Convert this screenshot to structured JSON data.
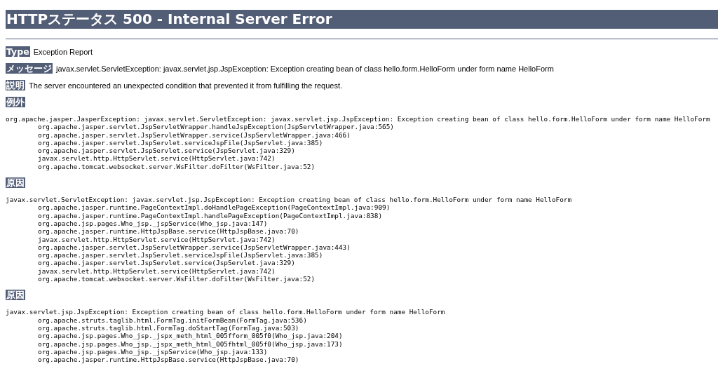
{
  "title": "HTTPステータス 500 - Internal Server Error",
  "fields": [
    {
      "label": "Type",
      "text": "Exception Report"
    },
    {
      "label": "メッセージ",
      "text": "javax.servlet.ServletException: javax.servlet.jsp.JspException: Exception creating bean of class hello.form.HelloForm under form name HelloForm"
    },
    {
      "label": "説明",
      "text": "The server encountered an unexpected condition that prevented it from fulfilling the request."
    }
  ],
  "sections": [
    {
      "label": "例外",
      "head": "org.apache.jasper.JasperException: javax.servlet.ServletException: javax.servlet.jsp.JspException: Exception creating bean of class hello.form.HelloForm under form name HelloForm",
      "frames": [
        "org.apache.jasper.servlet.JspServletWrapper.handleJspException(JspServletWrapper.java:565)",
        "org.apache.jasper.servlet.JspServletWrapper.service(JspServletWrapper.java:466)",
        "org.apache.jasper.servlet.JspServlet.serviceJspFile(JspServlet.java:385)",
        "org.apache.jasper.servlet.JspServlet.service(JspServlet.java:329)",
        "javax.servlet.http.HttpServlet.service(HttpServlet.java:742)",
        "org.apache.tomcat.websocket.server.WsFilter.doFilter(WsFilter.java:52)"
      ]
    },
    {
      "label": "原因",
      "head": "javax.servlet.ServletException: javax.servlet.jsp.JspException: Exception creating bean of class hello.form.HelloForm under form name HelloForm",
      "frames": [
        "org.apache.jasper.runtime.PageContextImpl.doHandlePageException(PageContextImpl.java:909)",
        "org.apache.jasper.runtime.PageContextImpl.handlePageException(PageContextImpl.java:838)",
        "org.apache.jsp.pages.Who_jsp._jspService(Who_jsp.java:147)",
        "org.apache.jasper.runtime.HttpJspBase.service(HttpJspBase.java:70)",
        "javax.servlet.http.HttpServlet.service(HttpServlet.java:742)",
        "org.apache.jasper.servlet.JspServletWrapper.service(JspServletWrapper.java:443)",
        "org.apache.jasper.servlet.JspServlet.serviceJspFile(JspServlet.java:385)",
        "org.apache.jasper.servlet.JspServlet.service(JspServlet.java:329)",
        "javax.servlet.http.HttpServlet.service(HttpServlet.java:742)",
        "org.apache.tomcat.websocket.server.WsFilter.doFilter(WsFilter.java:52)"
      ]
    },
    {
      "label": "原因",
      "head": "javax.servlet.jsp.JspException: Exception creating bean of class hello.form.HelloForm under form name HelloForm",
      "frames": [
        "org.apache.struts.taglib.html.FormTag.initFormBean(FormTag.java:536)",
        "org.apache.struts.taglib.html.FormTag.doStartTag(FormTag.java:503)",
        "org.apache.jsp.pages.Who_jsp._jspx_meth_html_005fform_005f0(Who_jsp.java:204)",
        "org.apache.jsp.pages.Who_jsp._jspx_meth_html_005fhtml_005f0(Who_jsp.java:173)",
        "org.apache.jsp.pages.Who_jsp._jspService(Who_jsp.java:133)",
        "org.apache.jasper.runtime.HttpJspBase.service(HttpJspBase.java:70)"
      ]
    }
  ]
}
